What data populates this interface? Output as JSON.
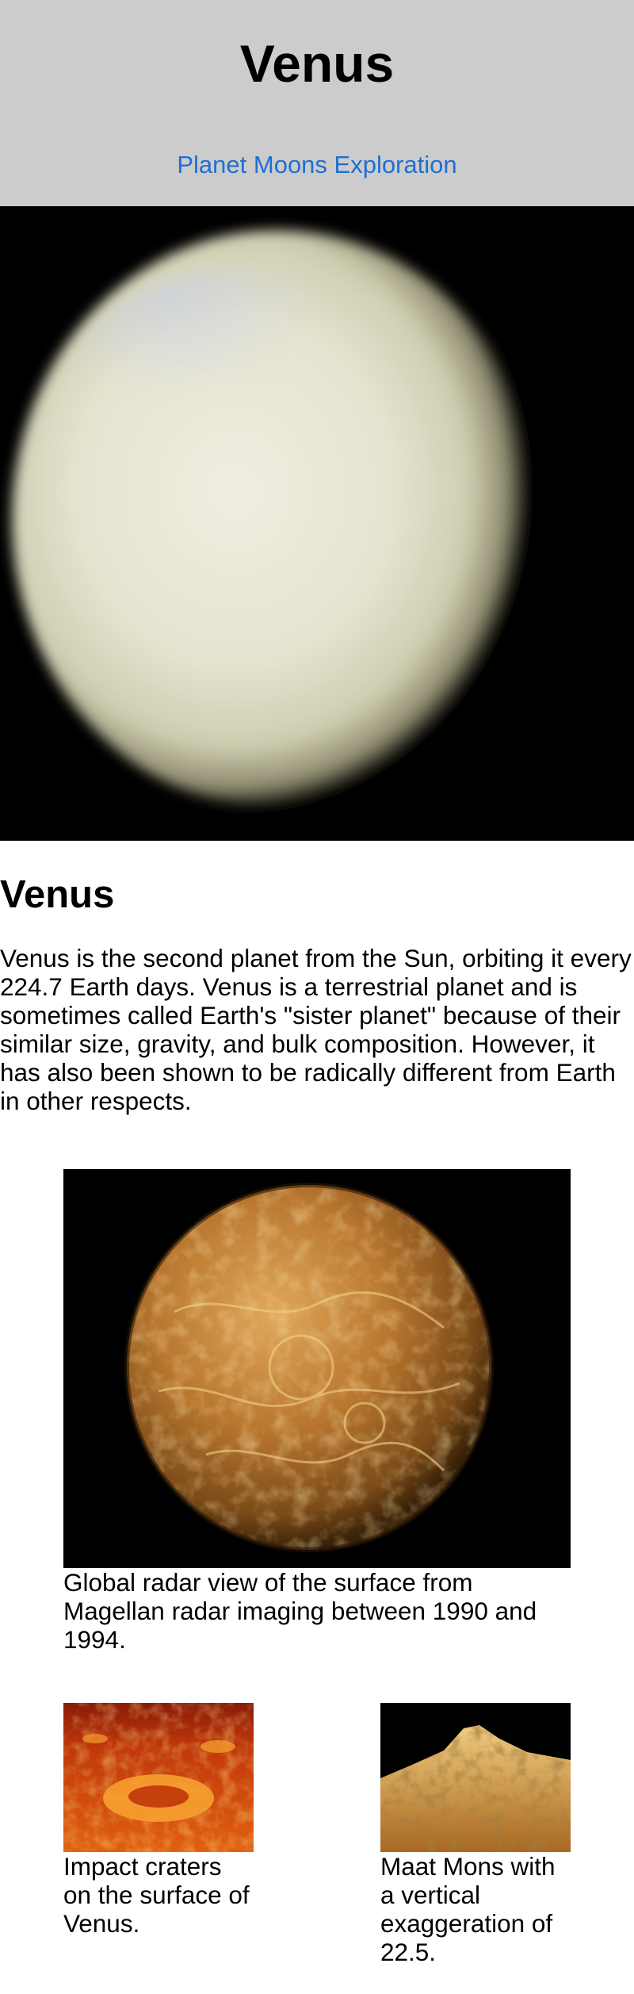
{
  "header": {
    "title": "Venus",
    "nav": [
      "Planet",
      "Moons",
      "Exploration"
    ]
  },
  "hero_image": {
    "icon": "venus-planet-photo"
  },
  "article": {
    "heading": "Venus",
    "intro": "Venus is the second planet from the Sun, orbiting it every 224.7 Earth days. Venus is a terrestrial planet and is sometimes called Earth's \"sister planet\" because of their similar size, gravity, and bulk composition. However, it has also been shown to be radically different from Earth in other respects."
  },
  "figures": [
    {
      "caption": "Global radar view of the surface from Magellan radar imaging between 1990 and 1994."
    },
    {
      "caption": "Impact craters on the surface of Venus."
    },
    {
      "caption": "Maat Mons with a vertical exaggeration of 22.5."
    }
  ],
  "colors": {
    "header_bg": "#cccccc",
    "link": "#1f6fd1"
  }
}
